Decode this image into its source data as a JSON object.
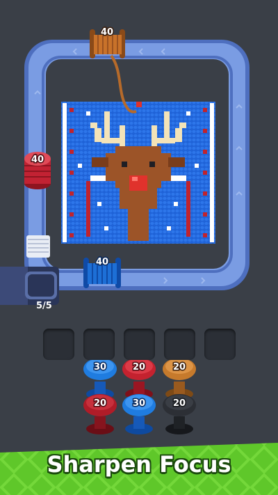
{
  "game": {
    "top_spool": {
      "count": "40",
      "color": "#c8722a"
    },
    "left_spool": {
      "count": "40",
      "color": "#c22233"
    },
    "belt_spool": {
      "count": "40",
      "color": "#1d6fd6"
    },
    "queue_counter": "5/5",
    "empty_slots": 5,
    "bobbins": [
      {
        "count": "30",
        "color": "#1f7ce0"
      },
      {
        "count": "20",
        "color": "#c4222f"
      },
      {
        "count": "20",
        "color": "#c67a2c"
      },
      {
        "count": "20",
        "color": "#b01c28"
      },
      {
        "count": "30",
        "color": "#1f7ce0"
      },
      {
        "count": "20",
        "color": "#2c2f35"
      }
    ]
  },
  "banner": {
    "title": "Sharpen Focus",
    "color": "#5fc72a"
  },
  "colors": {
    "background": "#3a3f47",
    "belt": "#6d8fd6",
    "board_blue": "#1f63d8",
    "antler": "#f3e3b8",
    "reindeer_brown": "#9c5428",
    "nose": "#e0322c"
  }
}
